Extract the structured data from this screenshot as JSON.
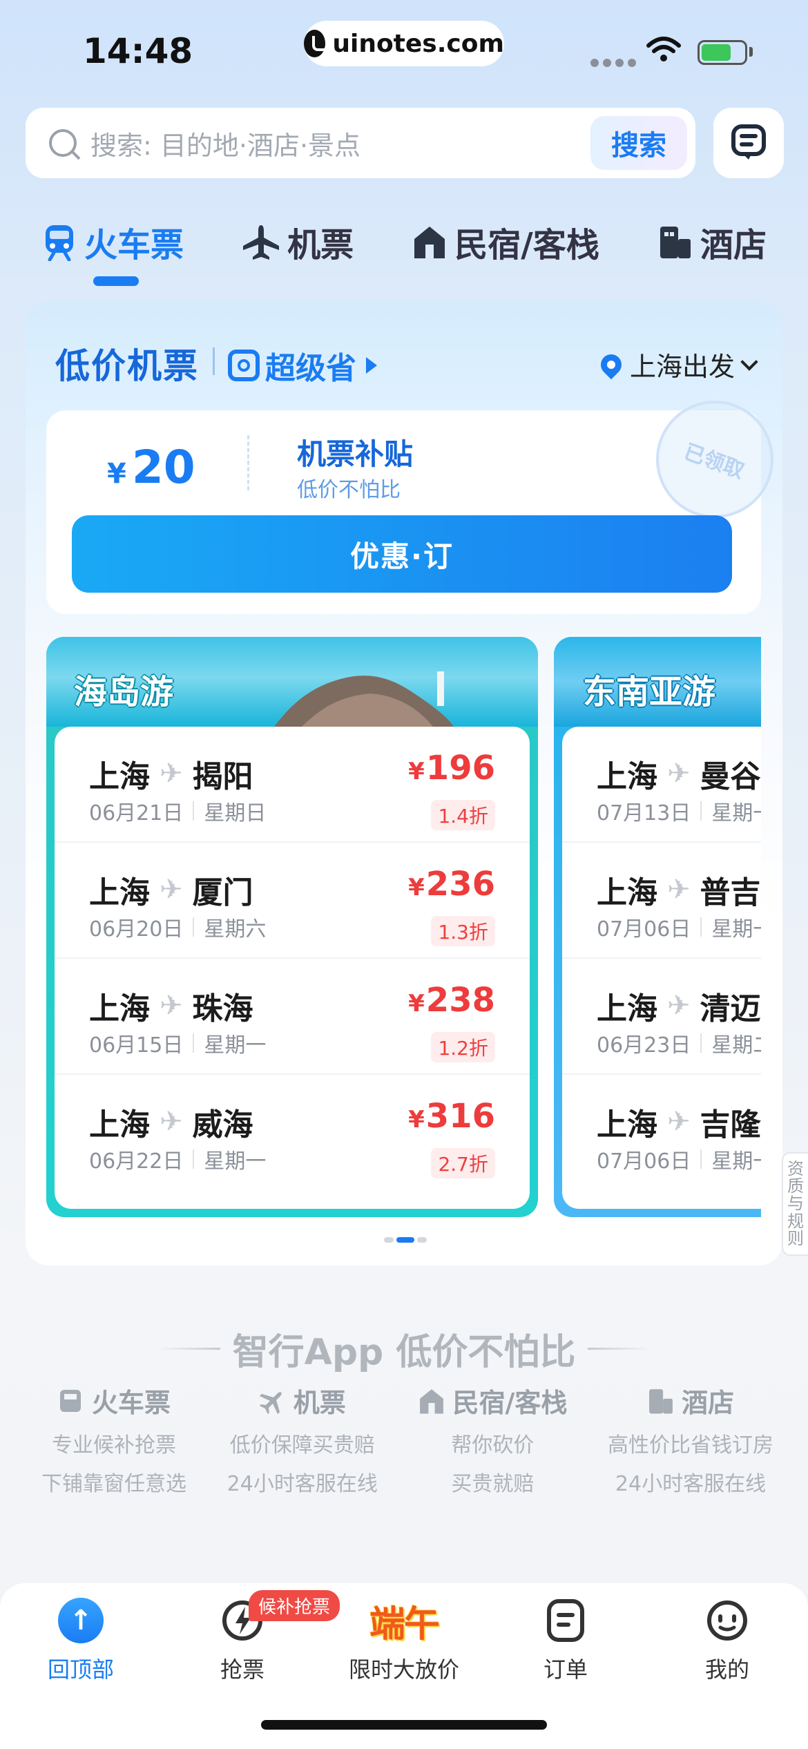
{
  "status_bar": {
    "time": "14:48",
    "url": "uinotes.com"
  },
  "search": {
    "placeholder": "搜索: 目的地·酒店·景点",
    "button_label": "搜索"
  },
  "tabs": [
    {
      "label": "火车票",
      "icon": "train-icon",
      "active": true
    },
    {
      "label": "机票",
      "icon": "plane-icon",
      "active": false
    },
    {
      "label": "民宿/客栈",
      "icon": "house-icon",
      "active": false
    },
    {
      "label": "酒店",
      "icon": "hotel-icon",
      "active": false
    }
  ],
  "promo": {
    "title": "低价机票",
    "badge": "超级省",
    "departure": "上海出发",
    "coupon": {
      "currency": "¥",
      "amount": "20",
      "title": "机票补贴",
      "subtitle": "低价不怕比",
      "stamp": "已领取"
    },
    "book_button": "优惠·订"
  },
  "route_cards": [
    {
      "title": "海岛游",
      "routes": [
        {
          "from": "上海",
          "to": "揭阳",
          "date": "06月21日",
          "weekday": "星期日",
          "price": "196",
          "discount": "1.4折"
        },
        {
          "from": "上海",
          "to": "厦门",
          "date": "06月20日",
          "weekday": "星期六",
          "price": "236",
          "discount": "1.3折"
        },
        {
          "from": "上海",
          "to": "珠海",
          "date": "06月15日",
          "weekday": "星期一",
          "price": "238",
          "discount": "1.2折"
        },
        {
          "from": "上海",
          "to": "威海",
          "date": "06月22日",
          "weekday": "星期一",
          "price": "316",
          "discount": "2.7折"
        }
      ]
    },
    {
      "title": "东南亚游",
      "routes": [
        {
          "from": "上海",
          "to": "曼谷",
          "date": "07月13日",
          "weekday": "星期一"
        },
        {
          "from": "上海",
          "to": "普吉",
          "date": "07月06日",
          "weekday": "星期一"
        },
        {
          "from": "上海",
          "to": "清迈",
          "date": "06月23日",
          "weekday": "星期二"
        },
        {
          "from": "上海",
          "to": "吉隆",
          "date": "07月06日",
          "weekday": "星期一"
        }
      ]
    }
  ],
  "side_tab": "资质与规则",
  "slogan": "智行App 低价不怕比",
  "features": [
    {
      "title": "火车票",
      "icon": "train-ticket-icon",
      "line1": "专业候补抢票",
      "line2": "下铺靠窗任意选"
    },
    {
      "title": "机票",
      "icon": "plane-icon",
      "line1": "低价保障买贵赔",
      "line2": "24小时客服在线"
    },
    {
      "title": "民宿/客栈",
      "icon": "house-icon",
      "line1": "帮你砍价",
      "line2": "买贵就赔"
    },
    {
      "title": "酒店",
      "icon": "hotel-icon",
      "line1": "高性价比省钱订房",
      "line2": "24小时客服在线"
    }
  ],
  "bottom_nav": {
    "items": [
      {
        "label": "回顶部",
        "icon": "back-to-top-icon",
        "active": true
      },
      {
        "label": "抢票",
        "icon": "lightning-icon",
        "active": false
      },
      {
        "label": "限时大放价",
        "icon": "festival-logo",
        "active": false
      },
      {
        "label": "订单",
        "icon": "order-icon",
        "active": false
      },
      {
        "label": "我的",
        "icon": "profile-icon",
        "active": false
      }
    ],
    "badge": "候补抢票",
    "festival_text": "端午"
  },
  "colors": {
    "accent": "#1a7cf2",
    "price_red": "#ee3b3b",
    "island_teal": "#22d1d0",
    "sea_blue": "#4bb8f6"
  }
}
